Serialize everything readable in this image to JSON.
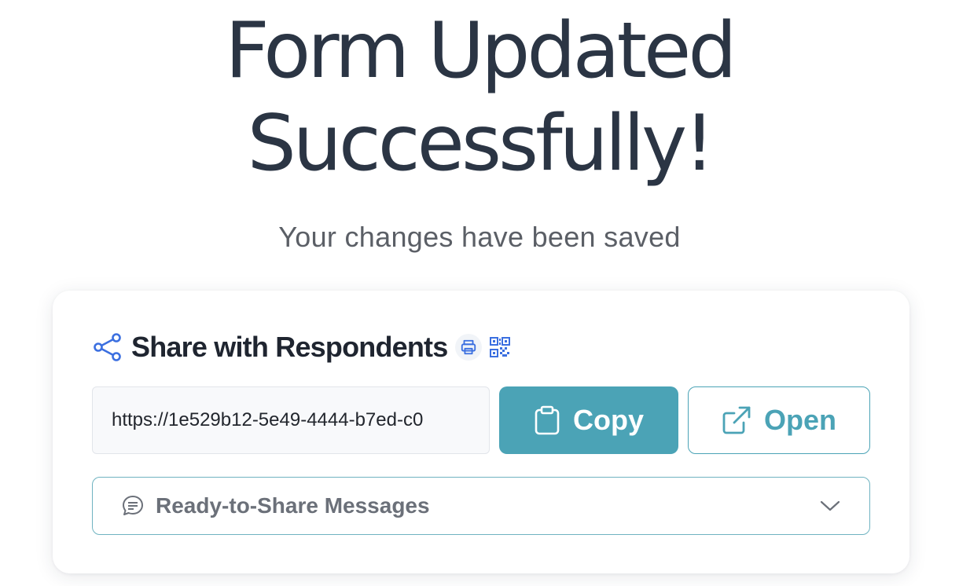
{
  "header": {
    "title_line1": "Form Updated",
    "title_line2": "Successfully!",
    "subtitle": "Your changes have been saved"
  },
  "share": {
    "title": "Share with Respondents",
    "url": "https://1e529b12-5e49-4444-b7ed-c0",
    "copy_label": "Copy",
    "open_label": "Open",
    "messages_label": "Ready-to-Share Messages"
  },
  "icons": {
    "share": "share-icon",
    "print": "printer-icon",
    "qr": "qr-code-icon",
    "copy": "clipboard-icon",
    "open": "external-link-icon",
    "messages": "chat-bubble-icon",
    "dropdown": "chevron-down-icon"
  },
  "colors": {
    "accent": "#4ba3b6",
    "title": "#2b3544",
    "share_icon": "#3b6fe0"
  }
}
